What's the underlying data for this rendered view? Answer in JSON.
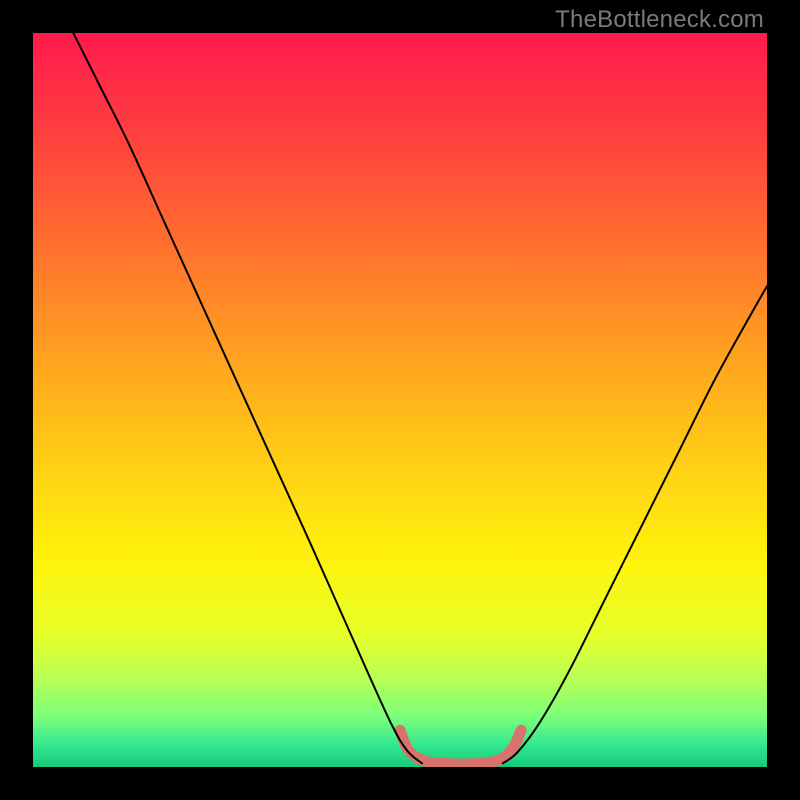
{
  "watermark": "TheBottleneck.com",
  "chart_data": {
    "type": "line",
    "title": "",
    "xlabel": "",
    "ylabel": "",
    "xlim": [
      0,
      1
    ],
    "ylim": [
      0,
      1
    ],
    "background_gradient": {
      "type": "vertical",
      "stops": [
        {
          "offset": 0.0,
          "color": "#ff1a4b"
        },
        {
          "offset": 0.12,
          "color": "#ff3a41"
        },
        {
          "offset": 0.28,
          "color": "#ff6d2f"
        },
        {
          "offset": 0.45,
          "color": "#ffa51f"
        },
        {
          "offset": 0.6,
          "color": "#ffd313"
        },
        {
          "offset": 0.72,
          "color": "#fff30b"
        },
        {
          "offset": 0.82,
          "color": "#e6ff2a"
        },
        {
          "offset": 0.88,
          "color": "#b8ff55"
        },
        {
          "offset": 0.93,
          "color": "#7dff7a"
        },
        {
          "offset": 0.97,
          "color": "#33e890"
        },
        {
          "offset": 1.0,
          "color": "#16c97a"
        }
      ]
    },
    "series": [
      {
        "name": "curve-left",
        "color": "#000000",
        "width": 2,
        "points": [
          {
            "x": 0.055,
            "y": 1.0
          },
          {
            "x": 0.09,
            "y": 0.93
          },
          {
            "x": 0.13,
            "y": 0.85
          },
          {
            "x": 0.18,
            "y": 0.74
          },
          {
            "x": 0.23,
            "y": 0.63
          },
          {
            "x": 0.28,
            "y": 0.52
          },
          {
            "x": 0.33,
            "y": 0.41
          },
          {
            "x": 0.38,
            "y": 0.3
          },
          {
            "x": 0.42,
            "y": 0.21
          },
          {
            "x": 0.46,
            "y": 0.12
          },
          {
            "x": 0.49,
            "y": 0.055
          },
          {
            "x": 0.51,
            "y": 0.022
          },
          {
            "x": 0.53,
            "y": 0.005
          }
        ]
      },
      {
        "name": "curve-right",
        "color": "#000000",
        "width": 2,
        "points": [
          {
            "x": 0.64,
            "y": 0.005
          },
          {
            "x": 0.66,
            "y": 0.02
          },
          {
            "x": 0.69,
            "y": 0.06
          },
          {
            "x": 0.73,
            "y": 0.13
          },
          {
            "x": 0.78,
            "y": 0.23
          },
          {
            "x": 0.83,
            "y": 0.33
          },
          {
            "x": 0.88,
            "y": 0.43
          },
          {
            "x": 0.93,
            "y": 0.53
          },
          {
            "x": 0.98,
            "y": 0.62
          },
          {
            "x": 1.0,
            "y": 0.655
          }
        ]
      },
      {
        "name": "flat-bottom-marker",
        "color": "#d9726c",
        "width": 11,
        "points": [
          {
            "x": 0.5,
            "y": 0.05
          },
          {
            "x": 0.51,
            "y": 0.025
          },
          {
            "x": 0.525,
            "y": 0.012
          },
          {
            "x": 0.545,
            "y": 0.006
          },
          {
            "x": 0.585,
            "y": 0.004
          },
          {
            "x": 0.62,
            "y": 0.006
          },
          {
            "x": 0.64,
            "y": 0.012
          },
          {
            "x": 0.655,
            "y": 0.028
          },
          {
            "x": 0.665,
            "y": 0.05
          }
        ]
      }
    ]
  }
}
